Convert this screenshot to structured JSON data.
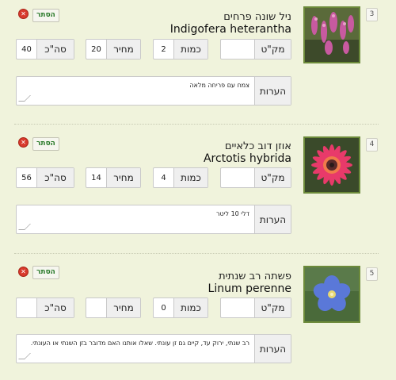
{
  "items": [
    {
      "index": "3",
      "name_he": "ניל שונה פרחים",
      "name_lat": "Indigofera heterantha",
      "hide_label": "הסתר",
      "sku_label": "מק\"ט",
      "sku_value": "",
      "qty_label": "כמות",
      "qty_value": "2",
      "price_label": "מחיר",
      "price_value": "20",
      "total_label": "סה\"כ",
      "total_value": "40",
      "notes_label": "הערות",
      "notes_value": "צמח עם פריחה מלאה",
      "photo": "pink-flower-spikes"
    },
    {
      "index": "4",
      "name_he": "אוזן דוב כלאיים",
      "name_lat": "Arctotis hybrida",
      "hide_label": "הסתר",
      "sku_label": "מק\"ט",
      "sku_value": "",
      "qty_label": "כמות",
      "qty_value": "4",
      "price_label": "מחיר",
      "price_value": "14",
      "total_label": "סה\"כ",
      "total_value": "56",
      "notes_label": "הערות",
      "notes_value": "דלי 10 ליטר",
      "photo": "pink-daisy"
    },
    {
      "index": "5",
      "name_he": "פשתה רב שנתית",
      "name_lat": "Linum perenne",
      "hide_label": "הסתר",
      "sku_label": "מק\"ט",
      "sku_value": "",
      "qty_label": "כמות",
      "qty_value": "0",
      "price_label": "מחיר",
      "price_value": "",
      "total_label": "סה\"כ",
      "total_value": "",
      "notes_label": "הערות",
      "notes_value": "רב שנתי, ירוק עד, קיים גם זן עונתי. שאלו אותנו האם מדובר בזן השנתי או העונתי.",
      "photo": "blue-flax-flower"
    }
  ]
}
